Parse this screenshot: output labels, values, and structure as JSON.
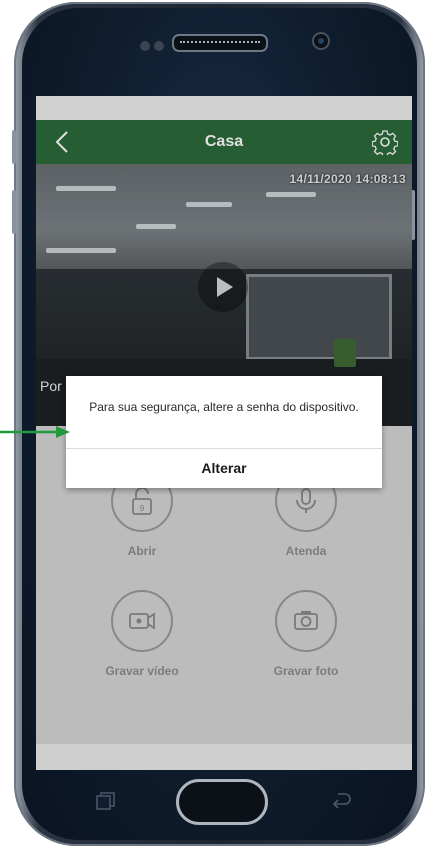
{
  "appbar": {
    "title": "Casa",
    "back_icon": "chevron-left-icon",
    "settings_icon": "gear-icon"
  },
  "video": {
    "timestamp": "14/11/2020 14:08:13",
    "label": "Por",
    "play_icon": "play-icon"
  },
  "controls": [
    {
      "label": "Abrir",
      "icon": "lock-icon"
    },
    {
      "label": "Atenda",
      "icon": "microphone-icon"
    },
    {
      "label": "Gravar vídeo",
      "icon": "video-camera-icon"
    },
    {
      "label": "Gravar foto",
      "icon": "camera-icon"
    }
  ],
  "dialog": {
    "message": "Para sua segurança, altere a senha do dispositivo.",
    "button": "Alterar"
  },
  "colors": {
    "appbar": "#2c6a3a",
    "arrow": "#1f9a3c"
  }
}
